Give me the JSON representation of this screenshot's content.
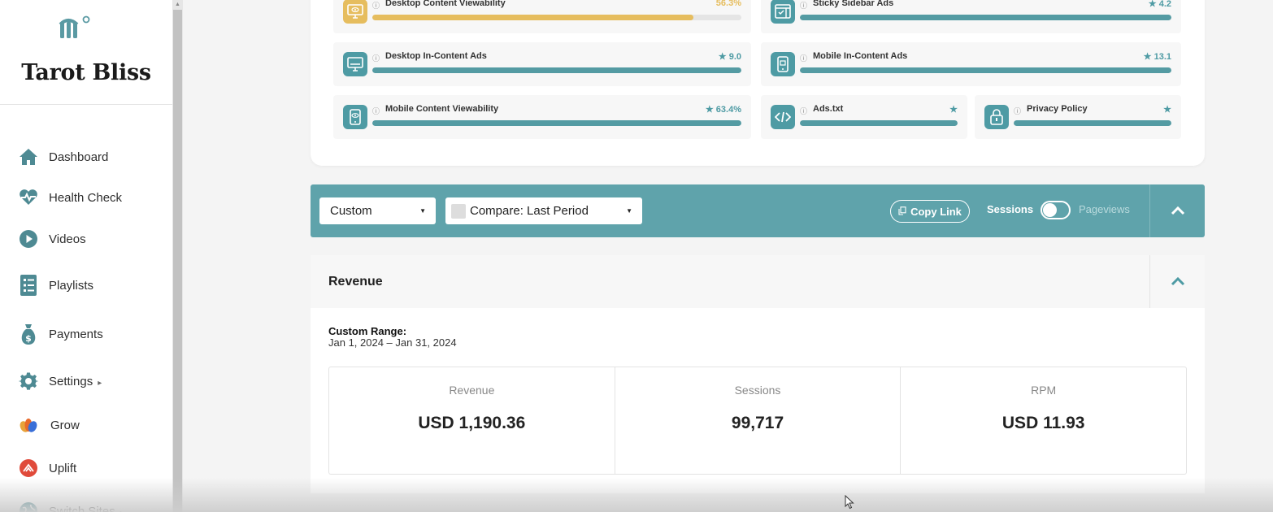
{
  "sidebar": {
    "site_title": "Tarot Bliss",
    "items": [
      {
        "label": "Dashboard",
        "icon": "home-icon"
      },
      {
        "label": "Health Check",
        "icon": "heartbeat-icon"
      },
      {
        "label": "Videos",
        "icon": "play-icon"
      },
      {
        "label": "Playlists",
        "icon": "list-icon"
      },
      {
        "label": "Payments",
        "icon": "money-bag-icon"
      },
      {
        "label": "Settings",
        "icon": "gear-icon",
        "caret": "▸"
      },
      {
        "label": "Grow",
        "icon": "grow-icon"
      },
      {
        "label": "Uplift",
        "icon": "uplift-icon"
      },
      {
        "label": "Switch Sites",
        "icon": "globe-icon",
        "caret": "▸"
      }
    ]
  },
  "metrics": [
    {
      "name": "Desktop Content Viewability",
      "score": "56.3%",
      "fill": 0.87,
      "color": "#e6bd5e",
      "icon": "desktop-eye-icon"
    },
    {
      "name": "Sticky Sidebar Ads",
      "score": "4.2",
      "fill": 1.0,
      "color": "#4e9ba4",
      "icon": "sidebar-ad-icon"
    },
    {
      "name": "Desktop In-Content Ads",
      "score": "9.0",
      "fill": 1.0,
      "color": "#4e9ba4",
      "icon": "desktop-icon"
    },
    {
      "name": "Mobile In-Content Ads",
      "score": "13.1",
      "fill": 1.0,
      "color": "#4e9ba4",
      "icon": "mobile-icon"
    },
    {
      "name": "Mobile Content Viewability",
      "score": "63.4%",
      "fill": 1.0,
      "color": "#4e9ba4",
      "icon": "mobile-eye-icon"
    },
    {
      "name": "Ads.txt",
      "score": "",
      "fill": 1.0,
      "color": "#4e9ba4",
      "icon": "code-icon"
    },
    {
      "name": "Privacy Policy",
      "score": "",
      "fill": 1.0,
      "color": "#4e9ba4",
      "icon": "lock-icon"
    }
  ],
  "filters": {
    "range_select": "Custom",
    "compare_select": "Compare: Last Period",
    "copy_link": "Copy Link",
    "sessions_label": "Sessions",
    "pageviews_label": "Pageviews"
  },
  "revenue": {
    "title": "Revenue",
    "range_label": "Custom Range:",
    "range_value": "Jan 1, 2024 – Jan 31, 2024",
    "stats": [
      {
        "label": "Revenue",
        "value": "USD 1,190.36"
      },
      {
        "label": "Sessions",
        "value": "99,717"
      },
      {
        "label": "RPM",
        "value": "USD 11.93"
      }
    ]
  },
  "colors": {
    "teal": "#5fa3ab",
    "bar_teal": "#549ba3",
    "yellow": "#e6bd5e"
  }
}
